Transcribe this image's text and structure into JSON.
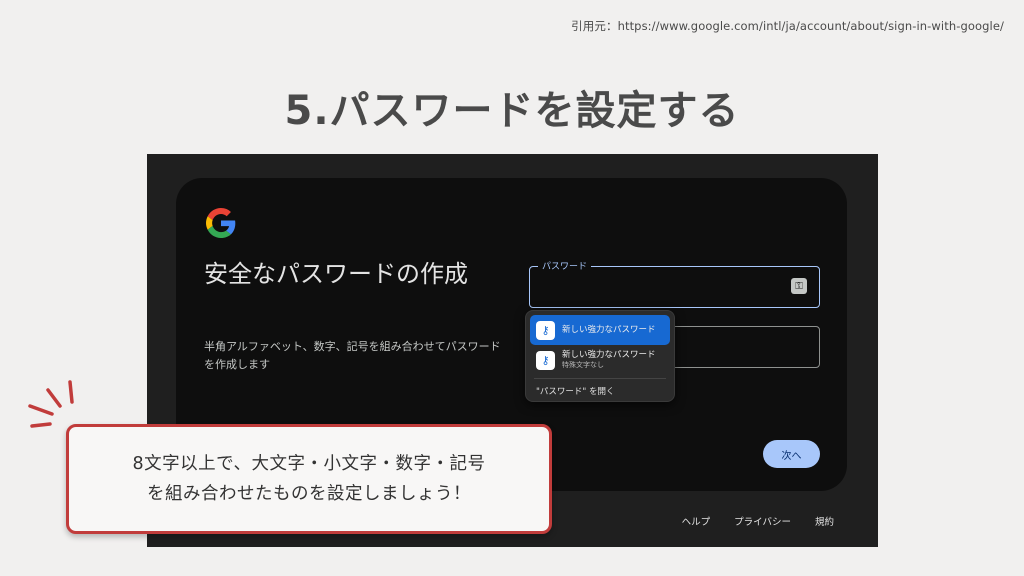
{
  "citation": "引用元：https://www.google.com/intl/ja/account/about/sign-in-with-google/",
  "slide_title": "5.パスワードを設定する",
  "screenshot": {
    "logo": "google-g-logo",
    "heading": "安全なパスワードの作成",
    "description": "半角アルファベット、数字、記号を組み合わせてパスワードを作成します",
    "password_label": "パスワード",
    "suggestions": [
      {
        "main": "新しい強力なパスワード",
        "sub": ""
      },
      {
        "main": "新しい強力なパスワード",
        "sub": "特殊文字なし"
      }
    ],
    "open_passwords": "\"パスワード\" を開く",
    "next_button": "次へ",
    "footer": {
      "help": "ヘルプ",
      "privacy": "プライバシー",
      "terms": "規約"
    }
  },
  "callout": {
    "line1": "8文字以上で、大文字・小文字・数字・記号",
    "line2": "を組み合わせたものを設定しましょう！"
  },
  "colors": {
    "accent": "#a8c7fa",
    "callout_border": "#c13c3b",
    "suggestion_highlight": "#1769d2"
  }
}
